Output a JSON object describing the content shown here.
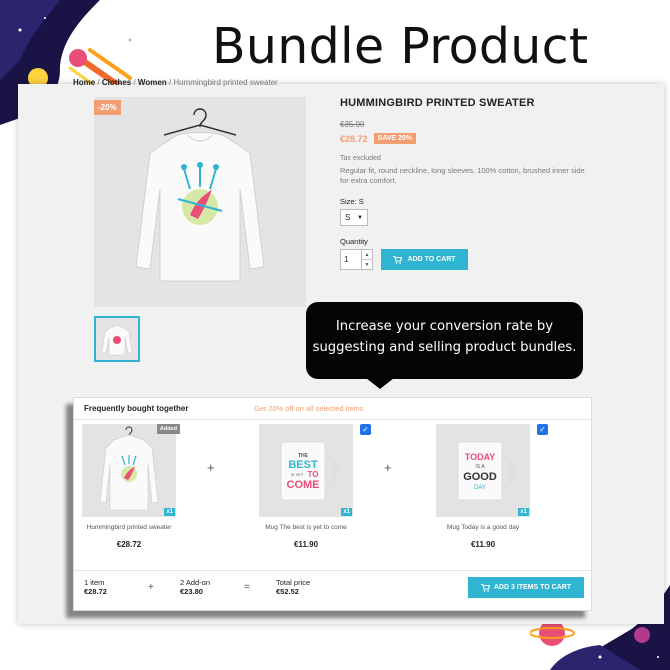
{
  "banner": {
    "title": "Bundle Product"
  },
  "breadcrumb": [
    "Home",
    "Clothes",
    "Women",
    "Hummingbird printed sweater"
  ],
  "product": {
    "discount_flag": "-20%",
    "title": "HUMMINGBIRD PRINTED SWEATER",
    "old_price": "€35.90",
    "new_price": "€28.72",
    "save_badge": "SAVE 20%",
    "tax_note": "Tax excluded",
    "description": "Regular fit, round neckline, long sleeves. 100% cotton, brushed inner side for extra comfort.",
    "size_label": "Size: S",
    "size_value": "S",
    "quantity_label": "Quantity",
    "quantity_value": "1",
    "add_to_cart": "ADD TO CART"
  },
  "tooltip": {
    "line1": "Increase your conversion rate by",
    "line2": "suggesting and selling product bundles."
  },
  "bundle": {
    "title": "Frequently bought together",
    "promo": "Get 20% off on all selected items",
    "items": [
      {
        "name": "Hummingbird printed sweater",
        "price": "€28.72",
        "badge": "Added",
        "qty": "x1"
      },
      {
        "name": "Mug The best is yet to come",
        "price": "€11.90",
        "qty": "x1",
        "mug_text": [
          "THE",
          "BEST",
          "IS YET",
          "TO",
          "COME"
        ]
      },
      {
        "name": "Mug Today is a good day",
        "price": "€11.90",
        "qty": "x1",
        "mug_text": [
          "TODAY",
          "IS A",
          "GOOD",
          "DAY"
        ]
      }
    ],
    "plus": "+",
    "footer": {
      "items_label": "1 item",
      "items_value": "€28.72",
      "addon_label": "2 Add-on",
      "addon_value": "€23.80",
      "total_label": "Total price",
      "total_value": "€52.52",
      "plus": "+",
      "equals": "=",
      "cart_button": "ADD 3 ITEMS TO CART"
    }
  },
  "colors": {
    "accent": "#2fb5d2",
    "discount": "#f39d72",
    "checkbox": "#1e73e8",
    "tooltip_bg": "#050505"
  },
  "icons": [
    "cart-icon",
    "chevron-down-icon",
    "check-icon",
    "planet-decoration",
    "comet-decoration"
  ]
}
